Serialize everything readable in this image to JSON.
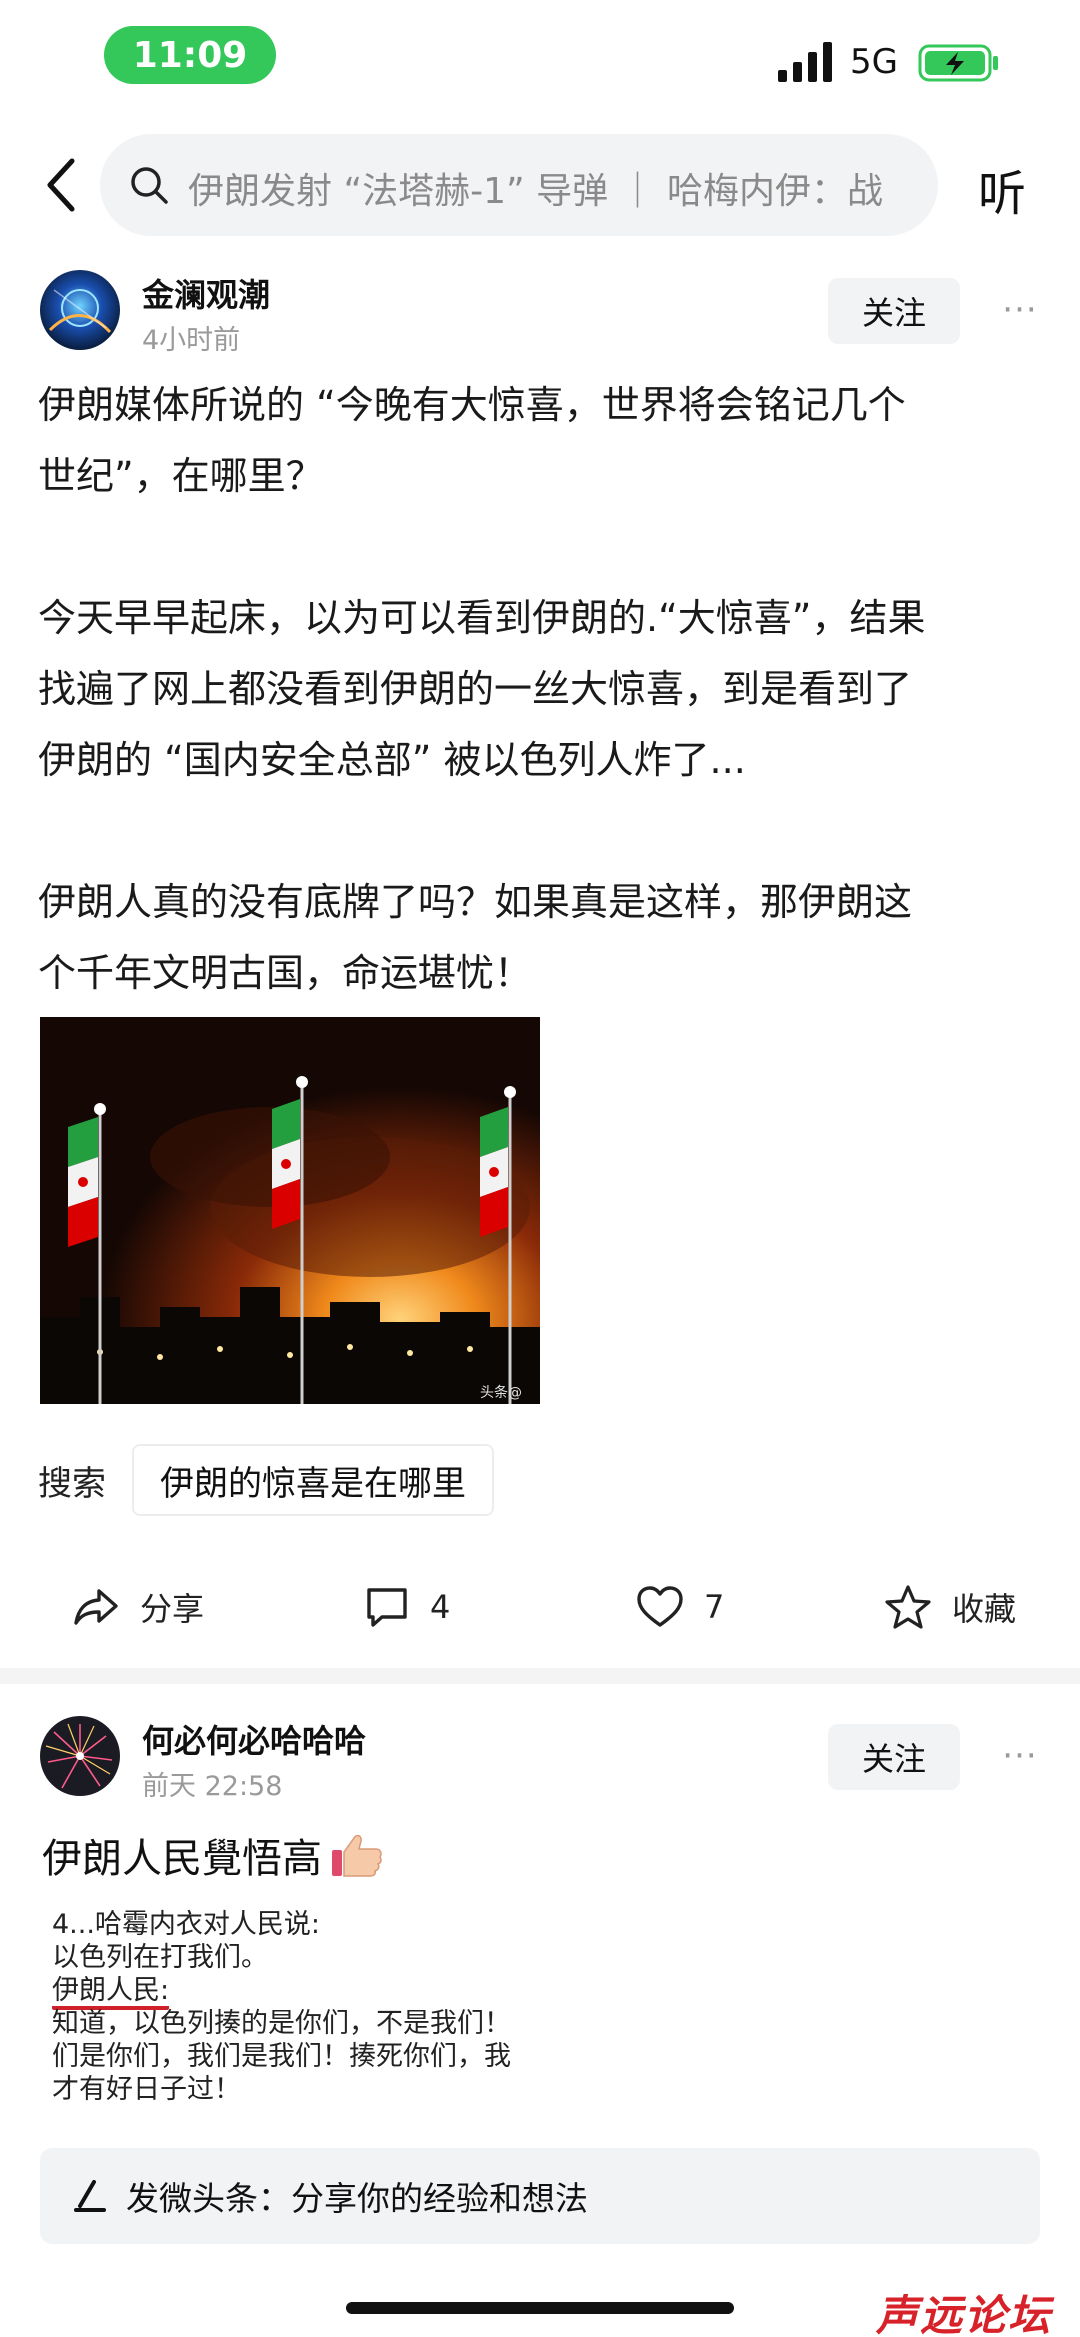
{
  "status_bar": {
    "time": "11:09",
    "network": "5G",
    "signal_icon": "signal-bars-icon",
    "battery_icon": "battery-charging-icon"
  },
  "nav": {
    "search_text": "伊朗发射 “法塔赫-1” 导弹 ｜ 哈梅内伊：战",
    "listen_label": "听"
  },
  "post1": {
    "author": "金澜观潮",
    "time": "4小时前",
    "follow_label": "关注",
    "more_label": "···",
    "para1": [
      "伊朗媒体所说的 “今晚有大惊喜，世界将会铭记几个",
      "世纪”，在哪里？"
    ],
    "para2": [
      "今天早早起床，以为可以看到伊朗的.“大惊喜”，结果",
      "找遍了网上都没看到伊朗的一丝大惊喜，到是看到了",
      "伊朗的 “国内安全总部” 被以色列人炸了..."
    ],
    "para3": [
      "伊朗人真的没有底牌了吗？如果真是这样，那伊朗这",
      "个千年文明古国，命运堪忧！"
    ],
    "image_watermark": "头条@"
  },
  "related_search": {
    "label": "搜索",
    "query": "伊朗的惊喜是在哪里"
  },
  "actions": {
    "share_label": "分享",
    "comments_count": "4",
    "likes_count": "7",
    "favorite_label": "收藏"
  },
  "post2": {
    "author": "何必何必哈哈哈",
    "time": "前天 22:58",
    "follow_label": "关注",
    "more_label": "···",
    "title": "伊朗人民覺悟高",
    "quote_lines": [
      "4...哈霉内衣对人民说:",
      "以色列在打我们。",
      "伊朗人民:",
      "知道，以色列揍的是你们，不是我们！",
      "们是你们，我们是我们！揍死你们，我",
      "才有好日子过！"
    ]
  },
  "compose": {
    "placeholder": "发微头条：分享你的经验和想法"
  },
  "watermark": "声远论坛",
  "colors": {
    "status_green": "#34c759",
    "underline_red": "#d0202a",
    "brand_red": "#d8222a"
  }
}
